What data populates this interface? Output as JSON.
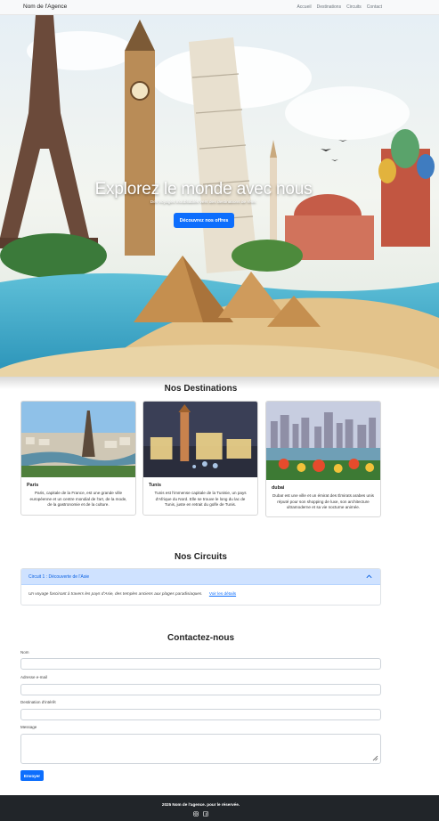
{
  "navbar": {
    "brand": "Nom de l'Agence",
    "links": [
      "Accueil",
      "Destinations",
      "Circuits",
      "Contact"
    ]
  },
  "hero": {
    "title": "Explorez le monde avec nous",
    "subtitle": "Des voyages inoubliables vers des destinations de rêve.",
    "button": "Découvrez nos offres"
  },
  "destinations": {
    "title": "Nos Destinations",
    "cards": [
      {
        "name": "Paris",
        "text": "Paris, capitale de la France, est une grande ville européenne et un centre mondial de l'art, de la mode, de la gastronomie et de la culture."
      },
      {
        "name": "Tunis",
        "text": "Tunis est l'immense capitale de la Tunisie, un pays d'Afrique du Nord. Elle se trouve le long du lac de Tunis, juste en retrait du golfe de Tunis."
      },
      {
        "name": "dubai",
        "text": "Dubaï est une ville et un émirat des Émirats arabes unis réputé pour son shopping de luxe, son architecture ultramoderne et sa vie nocturne animée."
      }
    ]
  },
  "circuits": {
    "title": "Nos Circuits",
    "item_title": "Circuit 1 : Découverte de l'Asie",
    "item_text": "Un voyage fascinant à travers les pays d'Asie, des temples anciens aux plages paradisiaques.",
    "item_link": "Voir les détails"
  },
  "contact": {
    "title": "Contactez-nous",
    "labels": {
      "name": "Nom",
      "email": "Adresse e-mail",
      "destination": "Destination d'intérêt",
      "message": "Message"
    },
    "submit": "Envoyer"
  },
  "footer": {
    "text": "2025 Nom de l'agence. pour le réservée."
  },
  "colors": {
    "primary": "#0d6efd",
    "footer_bg": "#212529",
    "accordion_bg": "#cfe2ff"
  },
  "icons": [
    "instagram-icon",
    "facebook-icon",
    "chevron-up-icon",
    "resize-handle-icon"
  ]
}
